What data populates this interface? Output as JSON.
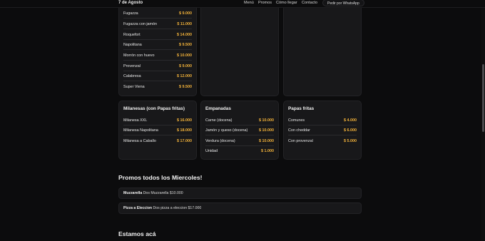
{
  "header": {
    "brand": "7 de Agosto",
    "nav": [
      "Menú",
      "Promos",
      "Cómo llegar",
      "Contacto"
    ],
    "whatsapp_button": "Pedir por WhatsApp"
  },
  "pizzas": {
    "items": [
      {
        "name": "Fugazza",
        "price": "$ 9.000"
      },
      {
        "name": "Fugazza con jamón",
        "price": "$ 11.000"
      },
      {
        "name": "Roquefort",
        "price": "$ 14.000"
      },
      {
        "name": "Napolitana",
        "price": "$ 9.500"
      },
      {
        "name": "Morrón con huevo",
        "price": "$ 10.000"
      },
      {
        "name": "Provenzal",
        "price": "$ 9.000"
      },
      {
        "name": "Calabresa",
        "price": "$ 12.000"
      },
      {
        "name": "Super Viena",
        "price": "$ 9.500"
      }
    ]
  },
  "milanesas": {
    "title": "Milanesas (con Papas fritas)",
    "items": [
      {
        "name": "Milanesa XXL",
        "price": "$ 16.000"
      },
      {
        "name": "Milanesa Napolitana",
        "price": "$ 18.000"
      },
      {
        "name": "Milanesa a Caballo",
        "price": "$ 17.000"
      }
    ]
  },
  "empanadas": {
    "title": "Empanadas",
    "items": [
      {
        "name": "Carne (docena)",
        "price": "$ 10.000"
      },
      {
        "name": "Jamón y queso (docena)",
        "price": "$ 10.000"
      },
      {
        "name": "Verdura (docena)",
        "price": "$ 10.000"
      },
      {
        "name": "Unidad",
        "price": "$ 1.000"
      }
    ]
  },
  "papas": {
    "title": "Papas fritas",
    "items": [
      {
        "name": "Comunes",
        "price": "$ 4.000"
      },
      {
        "name": "Con cheddar",
        "price": "$ 6.000"
      },
      {
        "name": "Con provenzal",
        "price": "$ 5.000"
      }
    ]
  },
  "promos": {
    "title": "Promos todos los Miercoles!",
    "items": [
      {
        "name": "Muzzarella",
        "desc": "Dos Muzzarella $10.000"
      },
      {
        "name": "Pizza a Eleccion",
        "desc": "Dos pizza a eleccion $17.000"
      }
    ]
  },
  "location": {
    "title": "Estamos acá"
  },
  "colors": {
    "accent": "#f2b23a",
    "background": "#0c0c0d",
    "card": "#18181a"
  }
}
